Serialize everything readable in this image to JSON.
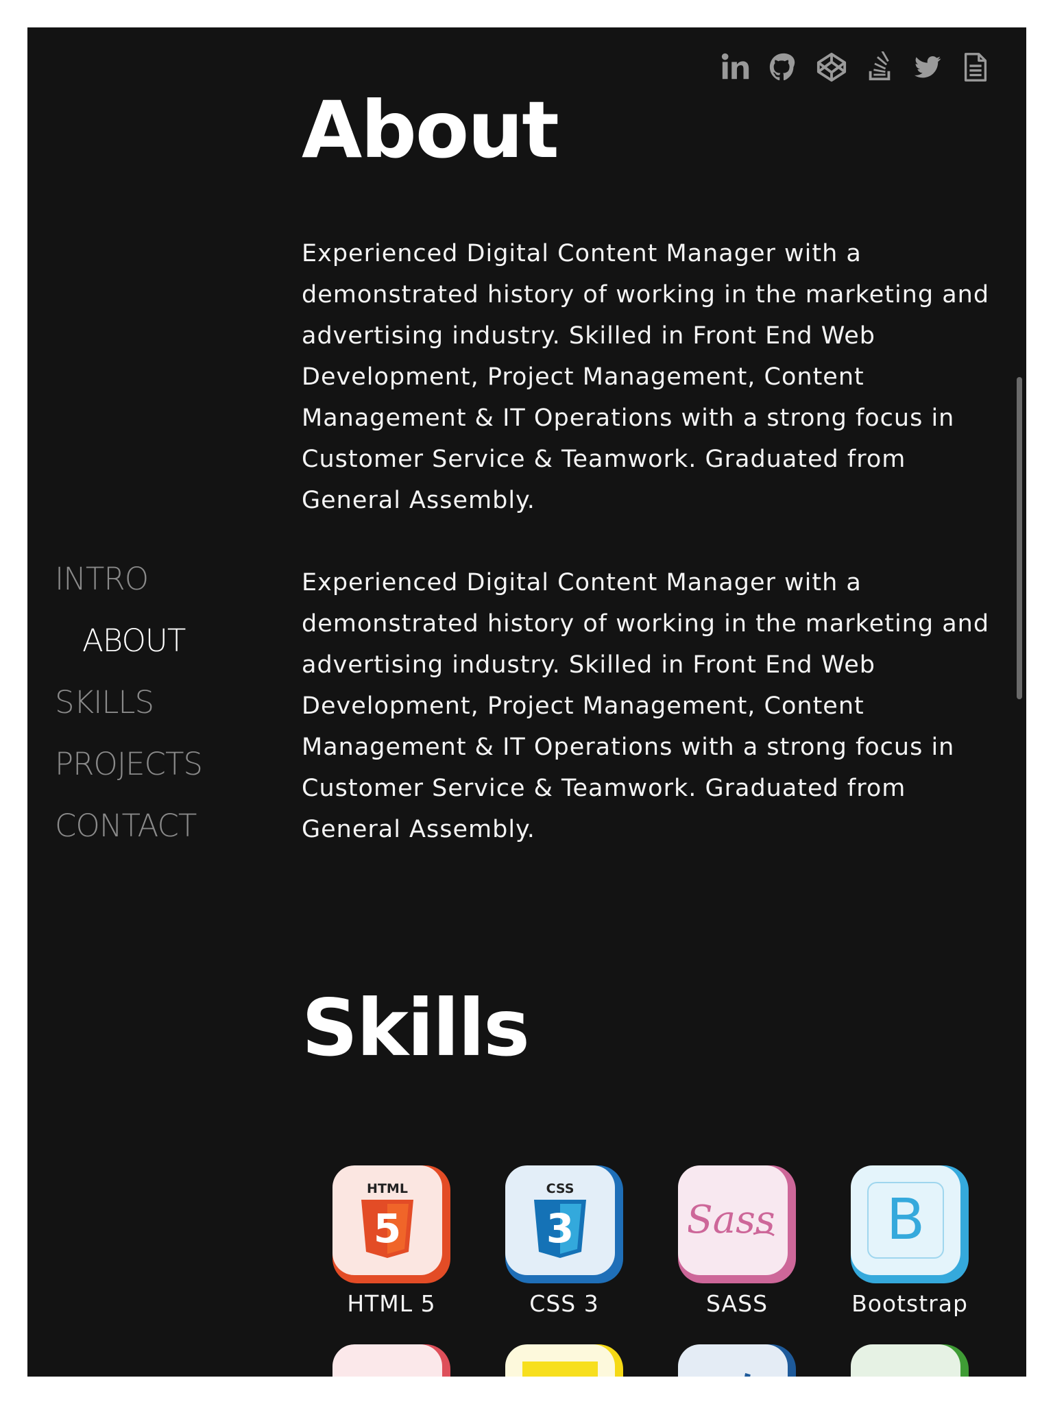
{
  "social": [
    {
      "name": "linkedin-icon"
    },
    {
      "name": "github-icon"
    },
    {
      "name": "codepen-icon"
    },
    {
      "name": "stackoverflow-icon"
    },
    {
      "name": "twitter-icon"
    },
    {
      "name": "resume-document-icon"
    }
  ],
  "nav": {
    "items": [
      "INTRO",
      "ABOUT",
      "SKILLS",
      "PROJECTS",
      "CONTACT"
    ],
    "active": "ABOUT"
  },
  "about": {
    "title": "About",
    "paragraph1": "Experienced Digital Content Manager with a demonstrated history of working in the marketing and advertising industry. Skilled in Front End Web Development, Project Management, Content Management & IT Operations with a strong focus in Customer Service & Teamwork. Graduated from General Assembly.",
    "paragraph2": "Experienced Digital Content Manager with a demonstrated history of working in the marketing and advertising industry. Skilled in Front End Web Development, Project Management, Content Management & IT Operations with a strong focus in Customer Service & Teamwork. Graduated from General Assembly."
  },
  "skills": {
    "title": "Skills",
    "items": [
      {
        "label": "HTML 5",
        "icon": "html5-icon",
        "color": "#e34c26",
        "bg": "#fbe6e1",
        "badge": "HTML",
        "glyph": "5"
      },
      {
        "label": "CSS 3",
        "icon": "css3-icon",
        "color": "#1f6fb8",
        "bg": "#e3eef8",
        "badge": "CSS",
        "glyph": "3"
      },
      {
        "label": "SASS",
        "icon": "sass-icon",
        "color": "#cd6799",
        "bg": "#f8e8f0",
        "glyph": "Sass"
      },
      {
        "label": "Bootstrap",
        "icon": "bootstrap-icon",
        "color": "#35a9dc",
        "bg": "#e4f4fb",
        "glyph": "B"
      },
      {
        "label": "",
        "icon": "meteor-icon",
        "color": "#de4f5a",
        "bg": "#fbe8ea",
        "glyph": ""
      },
      {
        "label": "",
        "icon": "javascript-icon",
        "color": "#f5d915",
        "bg": "#fdf9dc",
        "glyph": ""
      },
      {
        "label": "",
        "icon": "jquery-icon",
        "color": "#1e5a9a",
        "bg": "#e4ecf5",
        "glyph": ""
      },
      {
        "label": "",
        "icon": "nodejs-icon",
        "color": "#3f9c35",
        "bg": "#e6f2e4",
        "glyph": ""
      }
    ]
  }
}
